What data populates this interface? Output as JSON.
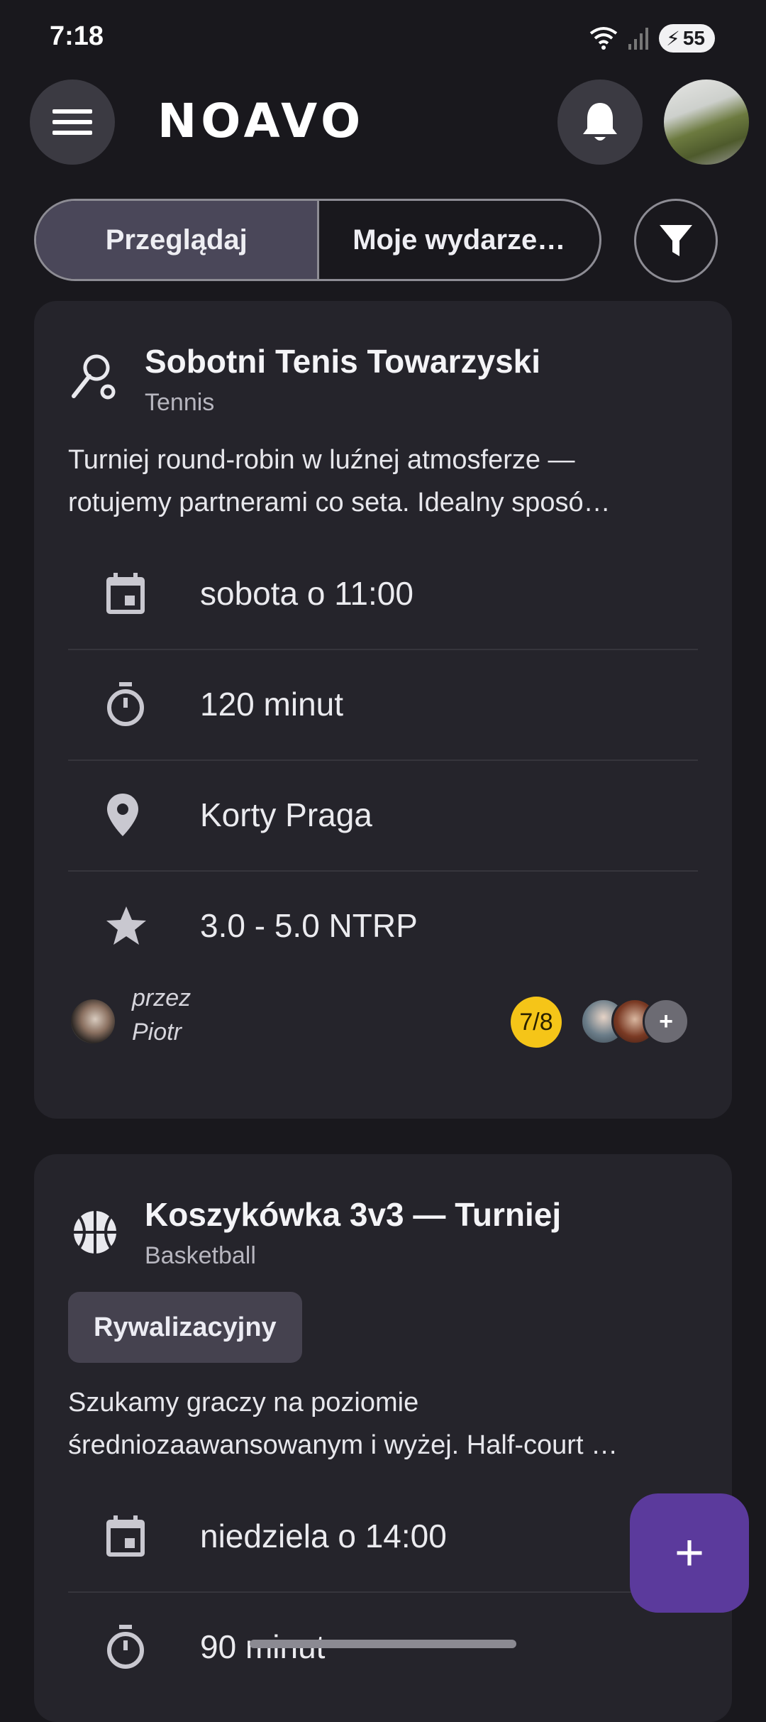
{
  "status_bar": {
    "time": "7:18",
    "battery": "55"
  },
  "header": {
    "logo_text": "NOAVO",
    "menu_icon": "menu-icon",
    "bell_icon": "bell-icon"
  },
  "tabs": [
    {
      "label": "Przeglądaj",
      "active": true
    },
    {
      "label": "Moje wydarze…",
      "active": false
    }
  ],
  "events": [
    {
      "title": "Sobotni Tenis Towarzyski",
      "sport": "Tennis",
      "sport_icon": "tennis-racket-icon",
      "description_line1": "Turniej round-robin w luźnej atmosferze —",
      "description_line2": "rotujemy partnerami co seta. Idealny sposó…",
      "details": [
        {
          "icon": "calendar-icon",
          "text": "sobota o 11:00"
        },
        {
          "icon": "timer-icon",
          "text": "120 minut"
        },
        {
          "icon": "location-icon",
          "text": "Korty Praga"
        },
        {
          "icon": "star-icon",
          "text": "3.0 - 5.0 NTRP"
        }
      ],
      "organizer_prefix": "przez",
      "organizer_name": "Piotr",
      "participants": "7/8",
      "more_label": "+"
    },
    {
      "title": "Koszykówka 3v3 — Turniej",
      "sport": "Basketball",
      "sport_icon": "basketball-icon",
      "tag": "Rywalizacyjny",
      "description_line1": "Szukamy graczy na poziomie",
      "description_line2": "średniozaawansowanym i wyżej. Half-court …",
      "details": [
        {
          "icon": "calendar-icon",
          "text": "niedziela o 14:00"
        },
        {
          "icon": "timer-icon",
          "text": "90 minut"
        }
      ]
    }
  ],
  "fab": {
    "label": "+"
  },
  "colors": {
    "accent": "#5b3a9c",
    "badge": "#f5c518",
    "background": "#19181d",
    "card": "#25242b"
  }
}
